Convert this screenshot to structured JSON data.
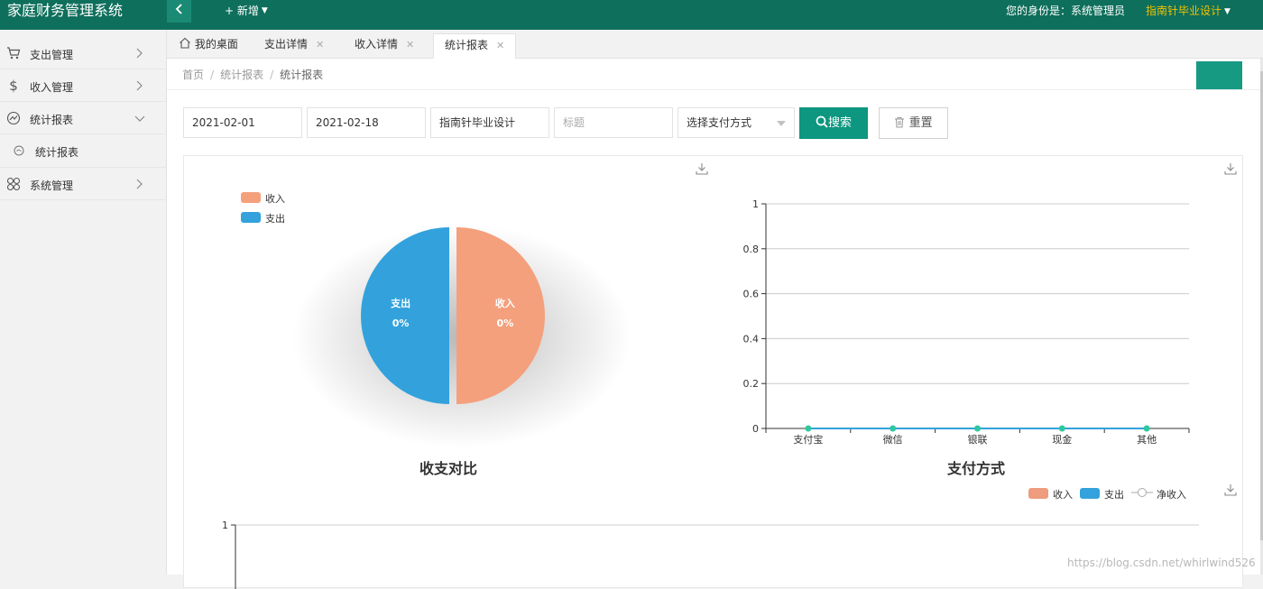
{
  "app": {
    "title": "家庭财务管理系统",
    "toggle_icon": "chevron-left-icon",
    "new_label": "+ 新增",
    "identity_label": "您的身份是：系统管理员",
    "username": "指南针毕业设计"
  },
  "sidebar": {
    "items": [
      {
        "label": "支出管理",
        "icon": "cart-icon"
      },
      {
        "label": "收入管理",
        "icon": "dollar-icon"
      },
      {
        "label": "统计报表",
        "icon": "chart-line-icon",
        "expanded": true
      },
      {
        "label": "统计报表",
        "icon": "circle-dot-icon",
        "submenu": true
      },
      {
        "label": "系统管理",
        "icon": "grid-icon"
      }
    ]
  },
  "tabs": [
    {
      "label": "我的桌面",
      "icon": "home-icon"
    },
    {
      "label": "支出详情",
      "closable": true
    },
    {
      "label": "收入详情",
      "closable": true
    },
    {
      "label": "统计报表",
      "closable": true,
      "active": true
    }
  ],
  "breadcrumb": [
    "首页",
    "统计报表",
    "统计报表"
  ],
  "filters": {
    "start_date": "2021-02-01",
    "end_date": "2021-02-18",
    "name": "指南针毕业设计",
    "title_placeholder": "标题",
    "payment_select": "选择支付方式",
    "search_label": "搜索",
    "reset_label": "重置"
  },
  "chart_data": [
    {
      "type": "pie",
      "title": "收支对比",
      "legend": [
        "收入",
        "支出"
      ],
      "slices": [
        {
          "name": "收入",
          "percent": "0%",
          "value": 0.5,
          "color": "#f4a07c"
        },
        {
          "name": "支出",
          "percent": "0%",
          "value": 0.5,
          "color": "#33a2dc"
        }
      ]
    },
    {
      "type": "line",
      "title": "支付方式",
      "categories": [
        "支付宝",
        "微信",
        "银联",
        "现金",
        "其他"
      ],
      "y_ticks": [
        "0",
        "0.2",
        "0.4",
        "0.6",
        "0.8",
        "1"
      ],
      "ylim": [
        0,
        1
      ],
      "series": [
        {
          "values": [
            0,
            0,
            0,
            0,
            0
          ],
          "color": "#2ec7a0"
        }
      ]
    },
    {
      "type": "bar",
      "legend": [
        {
          "name": "收入",
          "color": "#ef9b7e"
        },
        {
          "name": "支出",
          "color": "#33a2dc"
        },
        {
          "name": "净收入",
          "color": "#aaaaaa"
        }
      ],
      "y_ticks": [
        "1"
      ],
      "ylim": [
        0,
        1
      ]
    }
  ],
  "watermark": "https://blog.csdn.net/whirlwind526"
}
